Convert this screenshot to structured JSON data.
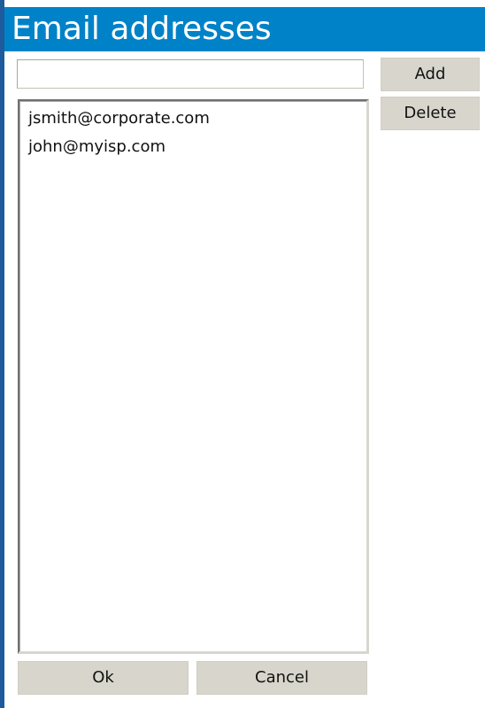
{
  "dialog": {
    "title": "Email addresses"
  },
  "email_input": {
    "value": "",
    "placeholder": ""
  },
  "buttons": {
    "add": "Add",
    "delete": "Delete",
    "ok": "Ok",
    "cancel": "Cancel"
  },
  "email_list": {
    "items": [
      "jsmith@corporate.com",
      "john@myisp.com"
    ]
  },
  "colors": {
    "title_bar": "#0082c8",
    "left_rule": "#1d5b9c",
    "button_face": "#d8d6cc"
  }
}
